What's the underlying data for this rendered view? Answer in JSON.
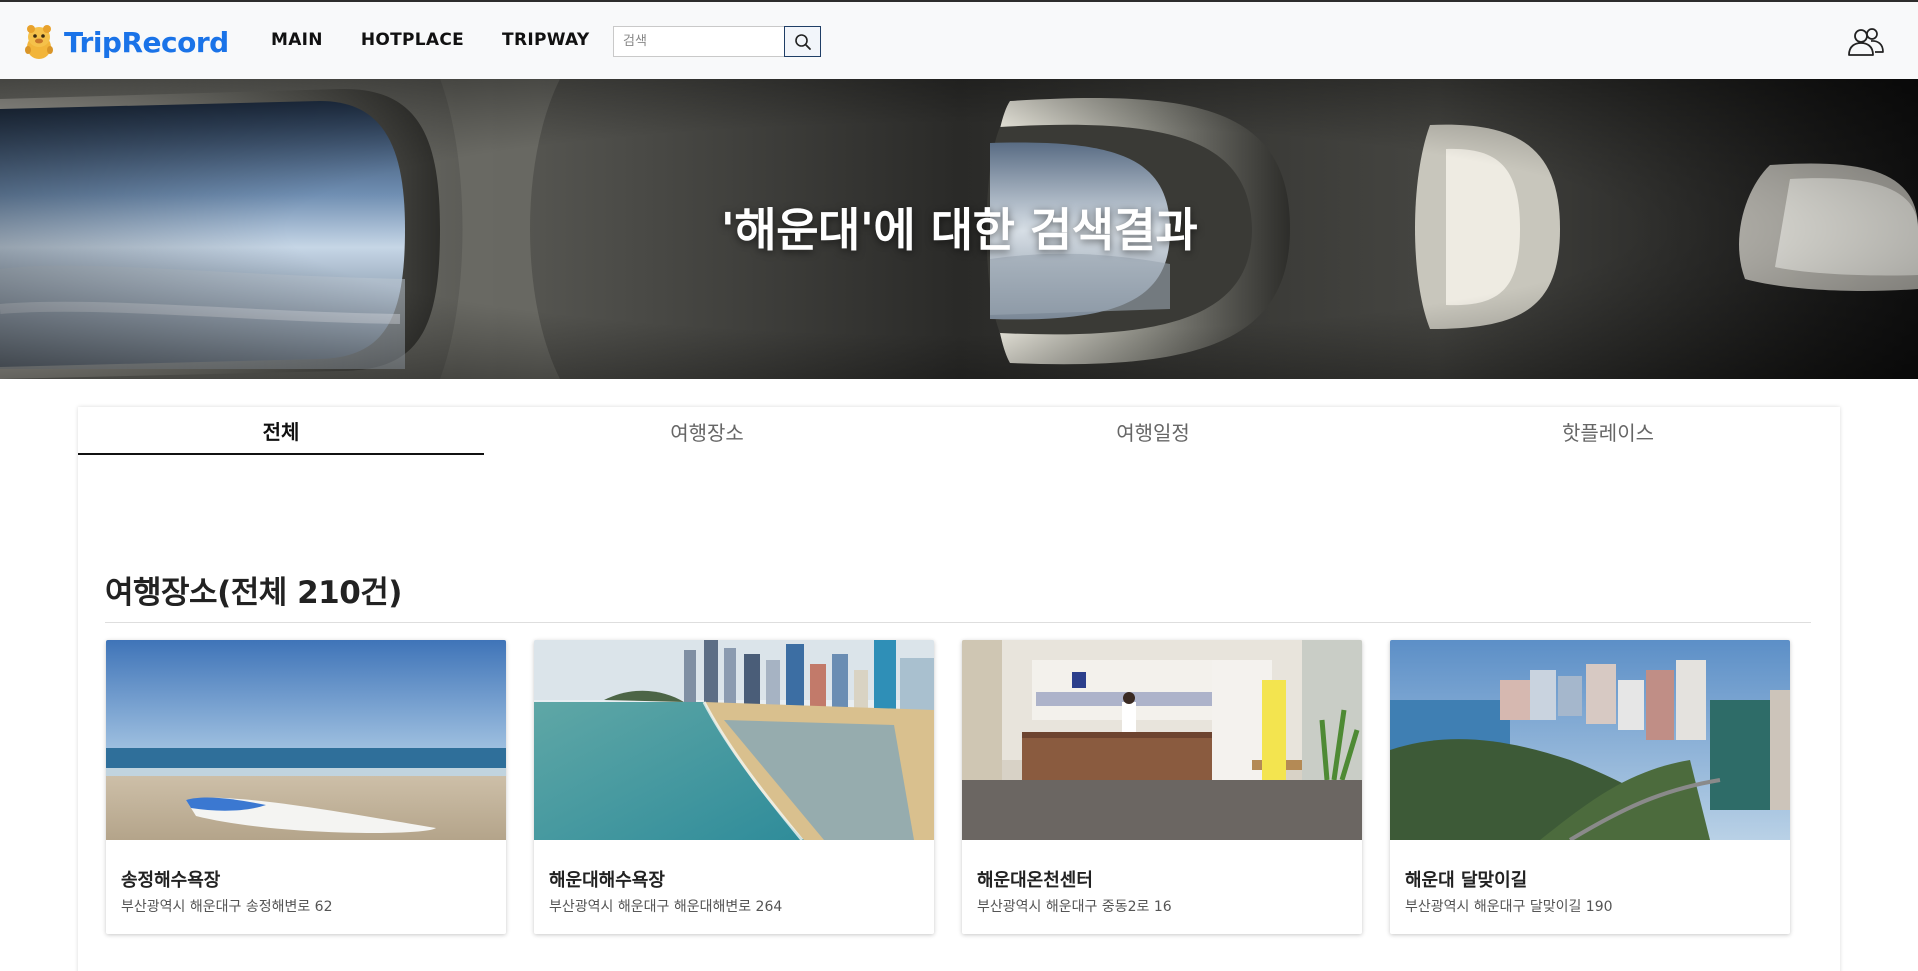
{
  "app": {
    "brand": "TripRecord",
    "accent_color": "#1a73e8"
  },
  "nav": {
    "items": [
      {
        "label": "MAIN"
      },
      {
        "label": "HOTPLACE"
      },
      {
        "label": "TRIPWAY"
      }
    ],
    "search": {
      "placeholder": "검색",
      "value": "",
      "button_icon": "search-icon"
    },
    "user_icon": "users-icon"
  },
  "hero": {
    "title": "'해운대'에 대한 검색결과"
  },
  "tabs": [
    {
      "label": "전체",
      "active": true
    },
    {
      "label": "여행장소",
      "active": false
    },
    {
      "label": "여행일정",
      "active": false
    },
    {
      "label": "핫플레이스",
      "active": false
    }
  ],
  "places_section": {
    "title": "여행장소(전체 210건)",
    "cards": [
      {
        "title": "송정해수욕장",
        "address": "부산광역시 해운대구 송정해변로 62"
      },
      {
        "title": "해운대해수욕장",
        "address": "부산광역시 해운대구 해운대해변로 264"
      },
      {
        "title": "해운대온천센터",
        "address": "부산광역시 해운대구 중동2로 16"
      },
      {
        "title": "해운대 달맞이길",
        "address": "부산광역시 해운대구 달맞이길 190"
      }
    ]
  }
}
